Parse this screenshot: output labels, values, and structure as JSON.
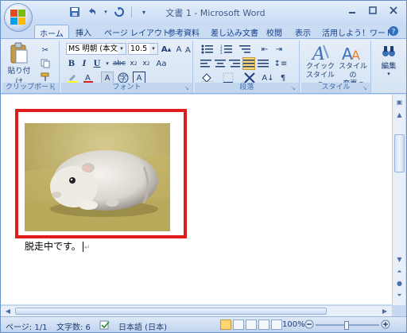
{
  "window": {
    "title": "文書 1 - Microsoft Word"
  },
  "qat": {
    "save_icon": "save-icon",
    "undo_icon": "undo-icon",
    "redo_icon": "redo-icon"
  },
  "tabs": [
    {
      "label": "ホーム",
      "active": true
    },
    {
      "label": "挿入"
    },
    {
      "label": "ページ レイアウト"
    },
    {
      "label": "参考資料"
    },
    {
      "label": "差し込み文書"
    },
    {
      "label": "校閲"
    },
    {
      "label": "表示"
    },
    {
      "label": "活用しよう！ワード"
    }
  ],
  "ribbon": {
    "clipboard": {
      "label": "クリップボード",
      "paste": "貼り付け"
    },
    "font": {
      "label": "フォント",
      "font_name": "MS 明朝 (本文",
      "font_size": "10.5"
    },
    "paragraph": {
      "label": "段落"
    },
    "style": {
      "label": "スタイル",
      "quick": "クイック\nスタイル ▾",
      "change": "スタイルの\n変更 ▾"
    },
    "edit": {
      "label": "編集"
    }
  },
  "document": {
    "text": "脱走中です。"
  },
  "statusbar": {
    "page": "ページ: 1/1",
    "words": "文字数: 6",
    "language": "日本語 (日本)",
    "zoom": "100%"
  },
  "colors": {
    "highlight_frame": "#e01c1c",
    "ribbon_bg": "#dbe7f6"
  }
}
